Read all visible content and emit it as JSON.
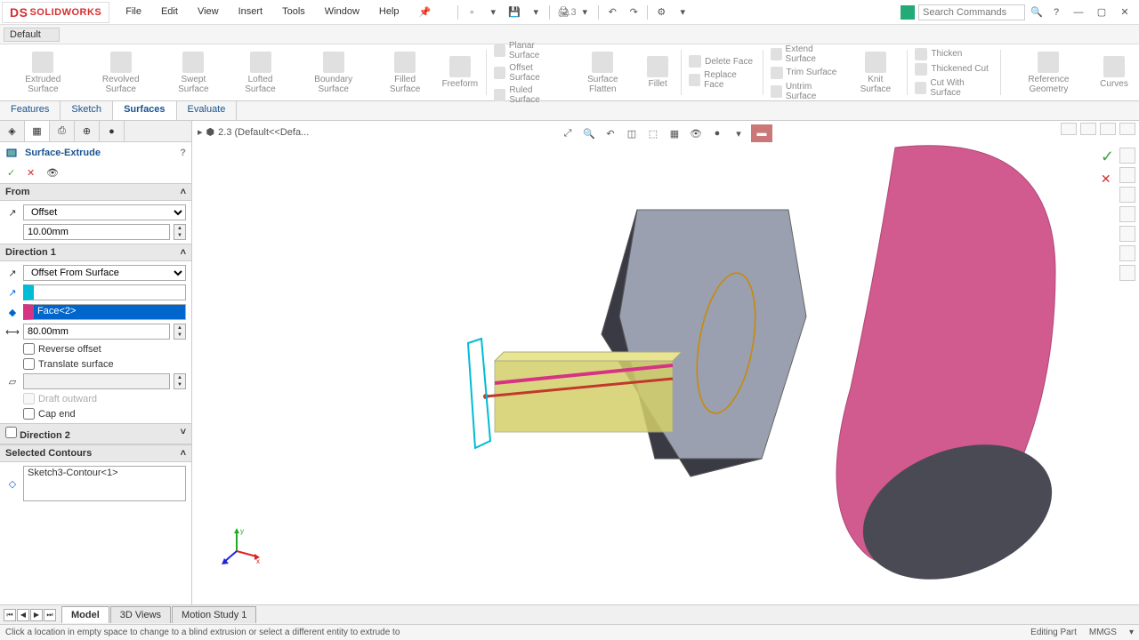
{
  "app": {
    "name": "SOLIDWORKS"
  },
  "menus": [
    "File",
    "Edit",
    "View",
    "Insert",
    "Tools",
    "Window",
    "Help"
  ],
  "doc_title": "2.3",
  "search": {
    "placeholder": "Search Commands"
  },
  "qa_config": "Default",
  "ribbon": {
    "big": [
      "Extruded Surface",
      "Revolved Surface",
      "Swept Surface",
      "Lofted Surface",
      "Boundary Surface",
      "Filled Surface",
      "Freeform"
    ],
    "group1": [
      "Planar Surface",
      "Offset Surface",
      "Ruled Surface"
    ],
    "mid": [
      "Surface Flatten"
    ],
    "group2": [
      "Delete Face",
      "Replace Face"
    ],
    "fillet": "Fillet",
    "group3": [
      "Extend Surface",
      "Trim Surface",
      "Untrim Surface"
    ],
    "knit": "Knit Surface",
    "group4": [
      "Thicken",
      "Thickened Cut",
      "Cut With Surface"
    ],
    "right": [
      "Reference Geometry",
      "Curves"
    ]
  },
  "tabs": [
    "Features",
    "Sketch",
    "Surfaces",
    "Evaluate"
  ],
  "active_tab": "Surfaces",
  "breadcrumb": "2.3 (Default<<Defa...",
  "feature": {
    "title": "Surface-Extrude",
    "from": {
      "label": "From",
      "mode": "Offset",
      "value": "10.00mm"
    },
    "dir1": {
      "label": "Direction 1",
      "mode": "Offset From Surface",
      "face_sel": "Face<2>",
      "depth": "80.00mm",
      "reverse_offset": "Reverse offset",
      "translate_surface": "Translate surface",
      "draft_outward": "Draft outward",
      "cap_end": "Cap end"
    },
    "dir2": {
      "label": "Direction 2"
    },
    "contours": {
      "label": "Selected Contours",
      "item": "Sketch3-Contour<1>"
    }
  },
  "bottom_tabs": [
    "Model",
    "3D Views",
    "Motion Study 1"
  ],
  "status": {
    "hint": "Click a location in empty space to change to a blind extrusion or select a different entity to extrude to",
    "mode": "Editing Part",
    "units": "MMGS"
  }
}
